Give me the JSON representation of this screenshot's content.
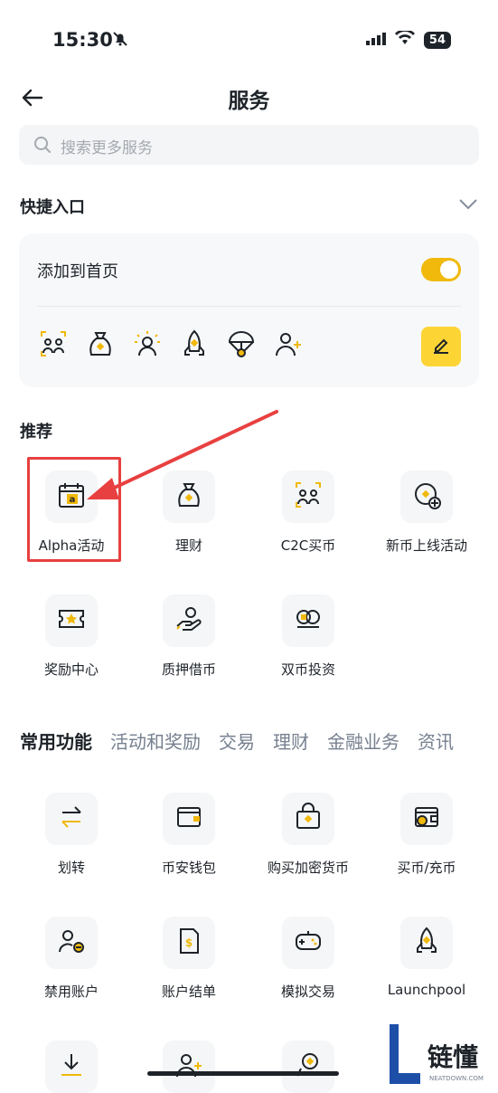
{
  "status_bar": {
    "time": "15:30",
    "battery": "54"
  },
  "header": {
    "title": "服务"
  },
  "search": {
    "placeholder": "搜索更多服务"
  },
  "quick_entry": {
    "section_title": "快捷入口",
    "add_to_home_label": "添加到首页",
    "add_to_home_enabled": true,
    "icons": [
      "c2c-icon",
      "money-bag-icon",
      "sun-user-icon",
      "rocket-icon",
      "parachute-icon",
      "add-user-icon"
    ]
  },
  "recommend": {
    "section_title": "推荐",
    "items": [
      {
        "label": "Alpha活动",
        "icon": "calendar-alpha-icon"
      },
      {
        "label": "理财",
        "icon": "money-bag-icon"
      },
      {
        "label": "C2C买币",
        "icon": "c2c-icon"
      },
      {
        "label": "新币上线活动",
        "icon": "new-coin-icon"
      },
      {
        "label": "奖励中心",
        "icon": "ticket-star-icon"
      },
      {
        "label": "质押借币",
        "icon": "hand-coin-icon"
      },
      {
        "label": "双币投资",
        "icon": "dual-coin-icon"
      }
    ]
  },
  "tabs": [
    "常用功能",
    "活动和奖励",
    "交易",
    "理财",
    "金融业务",
    "资讯"
  ],
  "common": {
    "items": [
      {
        "label": "划转",
        "icon": "transfer-icon"
      },
      {
        "label": "币安钱包",
        "icon": "wallet-icon"
      },
      {
        "label": "购买加密货币",
        "icon": "shopping-bag-icon"
      },
      {
        "label": "买币/充币",
        "icon": "buy-deposit-icon"
      },
      {
        "label": "禁用账户",
        "icon": "disable-account-icon"
      },
      {
        "label": "账户结单",
        "icon": "statement-icon"
      },
      {
        "label": "模拟交易",
        "icon": "gamepad-icon"
      },
      {
        "label": "Launchpool",
        "icon": "rocket-icon"
      },
      {
        "label": "",
        "icon": "download-icon"
      },
      {
        "label": "",
        "icon": "add-user-icon"
      },
      {
        "label": "",
        "icon": "chat-coin-icon"
      }
    ]
  },
  "watermark": {
    "text": "链懂",
    "subtext": "NEATDOWN.COM"
  },
  "colors": {
    "accent": "#f0b90b",
    "highlight": "#e84040",
    "text": "#1e2329"
  }
}
